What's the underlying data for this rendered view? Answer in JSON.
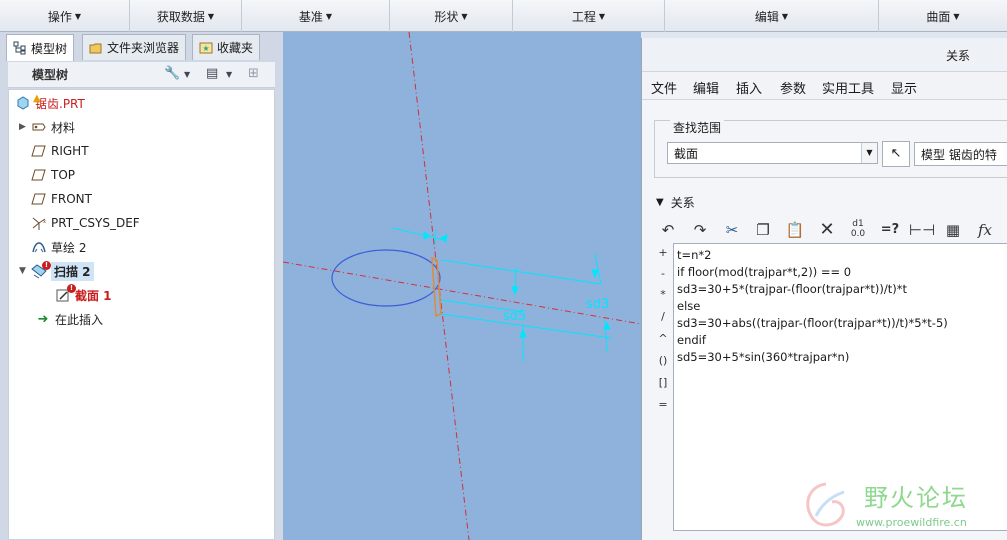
{
  "ribbon": {
    "groups": [
      {
        "label": "操作"
      },
      {
        "label": "获取数据"
      },
      {
        "label": "基准"
      },
      {
        "label": "形状"
      },
      {
        "label": "工程"
      },
      {
        "label": "编辑"
      },
      {
        "label": "曲面"
      }
    ]
  },
  "left_panel": {
    "tabs": [
      {
        "label": "模型树"
      },
      {
        "label": "文件夹浏览器"
      },
      {
        "label": "收藏夹"
      }
    ],
    "tree_title": "模型树",
    "nodes": [
      {
        "label": "锯齿.PRT",
        "icon": "part-icon"
      },
      {
        "label": "材料",
        "icon": "material-icon"
      },
      {
        "label": "RIGHT",
        "icon": "datum-plane-icon"
      },
      {
        "label": "TOP",
        "icon": "datum-plane-icon"
      },
      {
        "label": "FRONT",
        "icon": "datum-plane-icon"
      },
      {
        "label": "PRT_CSYS_DEF",
        "icon": "csys-icon"
      },
      {
        "label": "草绘 2",
        "icon": "sketch-icon"
      },
      {
        "label": "扫描 2",
        "icon": "sweep-icon"
      },
      {
        "label": "截面 1",
        "icon": "section-icon"
      },
      {
        "label": "在此插入",
        "icon": "insert-arrow-icon"
      }
    ]
  },
  "canvas": {
    "dim_labels": [
      "sd5",
      "sd3"
    ]
  },
  "dialog": {
    "title": "关系",
    "menu": [
      {
        "label": "文件"
      },
      {
        "label": "编辑"
      },
      {
        "label": "插入"
      },
      {
        "label": "参数"
      },
      {
        "label": "实用工具"
      },
      {
        "label": "显示"
      }
    ],
    "scope_legend": "查找范围",
    "scope_value": "截面",
    "model_field": "模型 锯齿的特",
    "relations_header": "关系",
    "operators": [
      "+",
      "-",
      "*",
      "/",
      "^",
      "()",
      "[]",
      "="
    ],
    "relations": [
      "t=n*2",
      "if floor(mod(trajpar*t,2)) == 0",
      "sd3=30+5*(trajpar-(floor(trajpar*t))/t)*t",
      "else",
      "sd3=30+abs((trajpar-(floor(trajpar*t))/t)*5*t-5)",
      "endif",
      "sd5=30+5*sin(360*trajpar*n)"
    ]
  },
  "watermark": {
    "title": "野火论坛",
    "url": "www.proewildfire.cn"
  },
  "colors": {
    "canvas_bg": "#8eb2dc",
    "dim_cyan": "#00e6ff",
    "axis_red": "#d0303a",
    "section_blue": "#3b5bdb",
    "error_red": "#c81e1e",
    "selection_bg": "#cfe4f7"
  }
}
